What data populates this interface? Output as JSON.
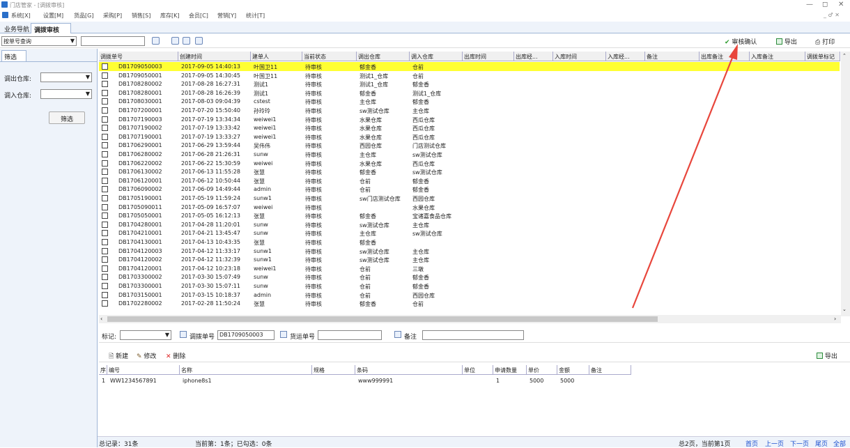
{
  "window": {
    "title": "门店管家 - [调拨审核]",
    "min": "—",
    "max": "◻",
    "close": "✕",
    "inner_controls": "_ ♂ ✕"
  },
  "menu": [
    "系统[X]",
    "设置[M]",
    "货品[G]",
    "采购[P]",
    "销售[S]",
    "库存[K]",
    "会员[C]",
    "营销[Y]",
    "统计[T]"
  ],
  "tabs": {
    "nav": "业务导航",
    "active": "调拨审核",
    "close": "✕"
  },
  "toolbar": {
    "query_mode": "按单号查询",
    "query_value": "",
    "approve": "审核确认",
    "export": "导出",
    "print": "打印"
  },
  "left": {
    "tab": "筛选",
    "out_wh_label": "调出仓库:",
    "in_wh_label": "调入仓库:",
    "filter_btn": "筛选"
  },
  "grid": {
    "headers": [
      "调拨单号",
      "创建时间",
      "建单人",
      "当前状态",
      "调出仓库",
      "调入仓库",
      "出库时间",
      "出库经...",
      "入库时间",
      "入库经...",
      "备注",
      "出库备注",
      "入库备注",
      "调拨单标记"
    ],
    "rows": [
      [
        "DB1709050003",
        "2017-09-05 14:40:13",
        "叶国卫11",
        "待审核",
        "郁金香",
        "仓前"
      ],
      [
        "DB1709050001",
        "2017-09-05 14:30:45",
        "叶国卫11",
        "待审核",
        "测试1_仓库",
        "仓前"
      ],
      [
        "DB1708280002",
        "2017-08-28 16:27:31",
        "测试1",
        "待审核",
        "测试1_仓库",
        "郁金香"
      ],
      [
        "DB1708280001",
        "2017-08-28 16:26:39",
        "测试1",
        "待审核",
        "郁金香",
        "测试1_仓库"
      ],
      [
        "DB1708030001",
        "2017-08-03 09:04:39",
        "cstest",
        "待审核",
        "主仓库",
        "郁金香"
      ],
      [
        "DB1707200001",
        "2017-07-20 15:50:40",
        "孙玲玲",
        "待审核",
        "sw测试仓库",
        "主仓库"
      ],
      [
        "DB1707190003",
        "2017-07-19 13:34:34",
        "weiwei1",
        "待审核",
        "水果仓库",
        "西瓜仓库"
      ],
      [
        "DB1707190002",
        "2017-07-19 13:33:42",
        "weiwei1",
        "待审核",
        "水果仓库",
        "西瓜仓库"
      ],
      [
        "DB1707190001",
        "2017-07-19 13:33:27",
        "weiwei1",
        "待审核",
        "水果仓库",
        "西瓜仓库"
      ],
      [
        "DB1706290001",
        "2017-06-29 13:59:44",
        "吴伟伟",
        "待审核",
        "西园仓库",
        "门店测试仓库"
      ],
      [
        "DB1706280002",
        "2017-06-28 21:26:31",
        "sunw",
        "待审核",
        "主仓库",
        "sw测试仓库"
      ],
      [
        "DB1706220002",
        "2017-06-22 15:30:59",
        "weiwei",
        "待审核",
        "水果仓库",
        "西瓜仓库"
      ],
      [
        "DB1706130002",
        "2017-06-13 11:55:28",
        "张慧",
        "待审核",
        "郁金香",
        "sw测试仓库"
      ],
      [
        "DB1706120001",
        "2017-06-12 10:50:44",
        "张慧",
        "待审核",
        "仓前",
        "郁金香"
      ],
      [
        "DB1706090002",
        "2017-06-09 14:49:44",
        "admin",
        "待审核",
        "仓前",
        "郁金香"
      ],
      [
        "DB1705190001",
        "2017-05-19 11:59:24",
        "sunw1",
        "待审核",
        "sw门店测试仓库",
        "西园仓库"
      ],
      [
        "DB1705090011",
        "2017-05-09 16:57:07",
        "weiwei",
        "待审核",
        "",
        "水果仓库"
      ],
      [
        "DB1705050001",
        "2017-05-05 16:12:13",
        "张慧",
        "待审核",
        "郁金香",
        "宝诸嘉食品仓库"
      ],
      [
        "DB1704280001",
        "2017-04-28 11:20:01",
        "sunw",
        "待审核",
        "sw测试仓库",
        "主仓库"
      ],
      [
        "DB1704210001",
        "2017-04-21 13:45:47",
        "sunw",
        "待审核",
        "主仓库",
        "sw测试仓库"
      ],
      [
        "DB1704130001",
        "2017-04-13 10:43:35",
        "张慧",
        "待审核",
        "郁金香",
        ""
      ],
      [
        "DB1704120003",
        "2017-04-12 11:33:17",
        "sunw1",
        "待审核",
        "sw测试仓库",
        "主仓库"
      ],
      [
        "DB1704120002",
        "2017-04-12 11:32:39",
        "sunw1",
        "待审核",
        "sw测试仓库",
        "主仓库"
      ],
      [
        "DB1704120001",
        "2017-04-12 10:23:18",
        "weiwei1",
        "待审核",
        "仓前",
        "三墩"
      ],
      [
        "DB1703300002",
        "2017-03-30 15:07:49",
        "sunw",
        "待审核",
        "仓前",
        "郁金香"
      ],
      [
        "DB1703300001",
        "2017-03-30 15:07:11",
        "sunw",
        "待审核",
        "仓前",
        "郁金香"
      ],
      [
        "DB1703150001",
        "2017-03-15 10:18:37",
        "admin",
        "待审核",
        "仓前",
        "西园仓库"
      ],
      [
        "DB1702280002",
        "2017-02-28 11:50:24",
        "张慧",
        "待审核",
        "郁金香",
        "仓前"
      ]
    ]
  },
  "detail": {
    "mark_label": "标记:",
    "order_label": "调拨单号",
    "order_value": "DB1709050003",
    "ship_label": "货运单号",
    "note_label": "备注"
  },
  "actions": {
    "new": "新建",
    "edit": "修改",
    "delete": "删除",
    "export": "导出"
  },
  "dgrid": {
    "headers": [
      "序",
      "编号",
      "名称",
      "规格",
      "条码",
      "单位",
      "申请数量",
      "单价",
      "金额",
      "备注"
    ],
    "rows": [
      [
        "1",
        "WW1234567891",
        "iphone8s1",
        "",
        "www999991",
        "",
        "1",
        "5000",
        "5000",
        ""
      ]
    ]
  },
  "status": {
    "total": "总记录：31条",
    "page_info": "当前第：1条；已勾选：0条",
    "pages": "总2页，当前第1页",
    "first": "首页",
    "prev": "上一页",
    "next": "下一页",
    "last": "尾页",
    "all": "全部"
  },
  "colors": {
    "selected_row": "#ffff33",
    "annotation_arrow": "#e8463c",
    "accent": "#2a6fc9"
  }
}
